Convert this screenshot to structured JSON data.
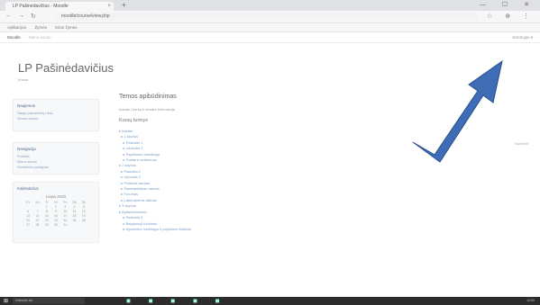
{
  "browser": {
    "tab_title": "LP Pašinėdavičius - Moodle",
    "tab_close": "×",
    "new_tab": "+",
    "window_controls": "— ☐ ✕",
    "nav_back": "←",
    "nav_forward": "→",
    "nav_reload": "↻",
    "url": "moodle/course/view.php",
    "toolbar_icons": "☆ ⊕ ⋮",
    "bookmarks": [
      "Aplikacijos",
      "Žymės",
      "Kitos žymės"
    ]
  },
  "site": {
    "brand": "Moodle",
    "nav_text": "Mano kursai",
    "user_menu": "Vartotojas ▾"
  },
  "page": {
    "title": "LP Pašinėdavičius",
    "breadcrumb": "Kursai"
  },
  "sidebar": {
    "block1": {
      "title": "Naujienos",
      "lines": [
        "Naujų pranešimų nėra",
        "Senos temos"
      ]
    },
    "block2": {
      "title": "Navigacija",
      "lines": [
        "Pradžia",
        "Mano kursai",
        "Svetainės puslapiai"
      ]
    },
    "calendar": {
      "label": "Kalendorius",
      "month": "Liepa 2020",
      "weekdays": [
        "Pr",
        "An",
        "Tr",
        "Kt",
        "Pn",
        "Še",
        "Sk"
      ],
      "days": [
        "",
        "",
        "1",
        "2",
        "3",
        "4",
        "5",
        "6",
        "7",
        "8",
        "9",
        "10",
        "11",
        "12",
        "13",
        "14",
        "15",
        "16",
        "17",
        "18",
        "19",
        "20",
        "21",
        "22",
        "23",
        "24",
        "25",
        "26",
        "27",
        "28",
        "29",
        "30",
        "31",
        "",
        ""
      ]
    }
  },
  "main": {
    "title": "Temos apibūdinimas",
    "description": "Įvadas į kursą ir bendra informacija",
    "subtitle": "Kursų turinys",
    "expand_label": "Išskleisti",
    "tree": [
      "▸ Įvadas",
      "  ▸ 1 skyrius",
      "    ▸ Paskaita 1",
      "    ▸ Užduotis 1",
      "    ▸ Papildoma medžiaga",
      "    ▸ Testas ir vertinimas",
      "▸ 2 skyrius",
      "  ▸ Paskaita 2",
      "  ▸ Užduotis 2",
      "  ▸ Praktinis darbas",
      "  ▸ Savarankiškas darbas",
      "  ▸ Forumas",
      "  ▸ Laboratorinis darbas",
      "▸ 3 skyrius",
      "▸ Apibendrinimas",
      "    ▸ Paskaita 3",
      "    ▸ Baigiamoji užduotis",
      "    ▸ Egzamino medžiaga ir papildomi šaltiniai"
    ]
  },
  "taskbar": {
    "start": "⊞",
    "search_placeholder": "Ieškokite čia",
    "icons": "◼ ◼ ◼ ◼ ◼",
    "clock": "12:00"
  },
  "annotation": {
    "arrow_color": "#3f6db5"
  }
}
